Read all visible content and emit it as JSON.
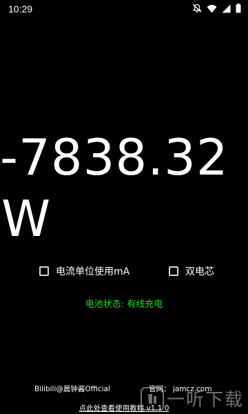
{
  "status_bar": {
    "time": "10:29",
    "icons": [
      "notifications-off-icon",
      "wifi-icon",
      "cellular-signal-icon",
      "battery-icon"
    ]
  },
  "reading": {
    "value": "-7838.32",
    "unit": "W"
  },
  "options": {
    "current_unit_ma": {
      "label": "电流单位使用mA",
      "checked": false
    },
    "dual_cell": {
      "label": "双电芯",
      "checked": false
    }
  },
  "battery_status": {
    "text": "电池状态: 有线充电",
    "color": "#22dd22"
  },
  "footer": {
    "credit": "Bilibili@晨钟酱Official",
    "website": "官网：  jamcz.com",
    "tutorial_link": "点此处查看使用教程  v1.1.0"
  },
  "watermark": {
    "text": "一听下载"
  }
}
